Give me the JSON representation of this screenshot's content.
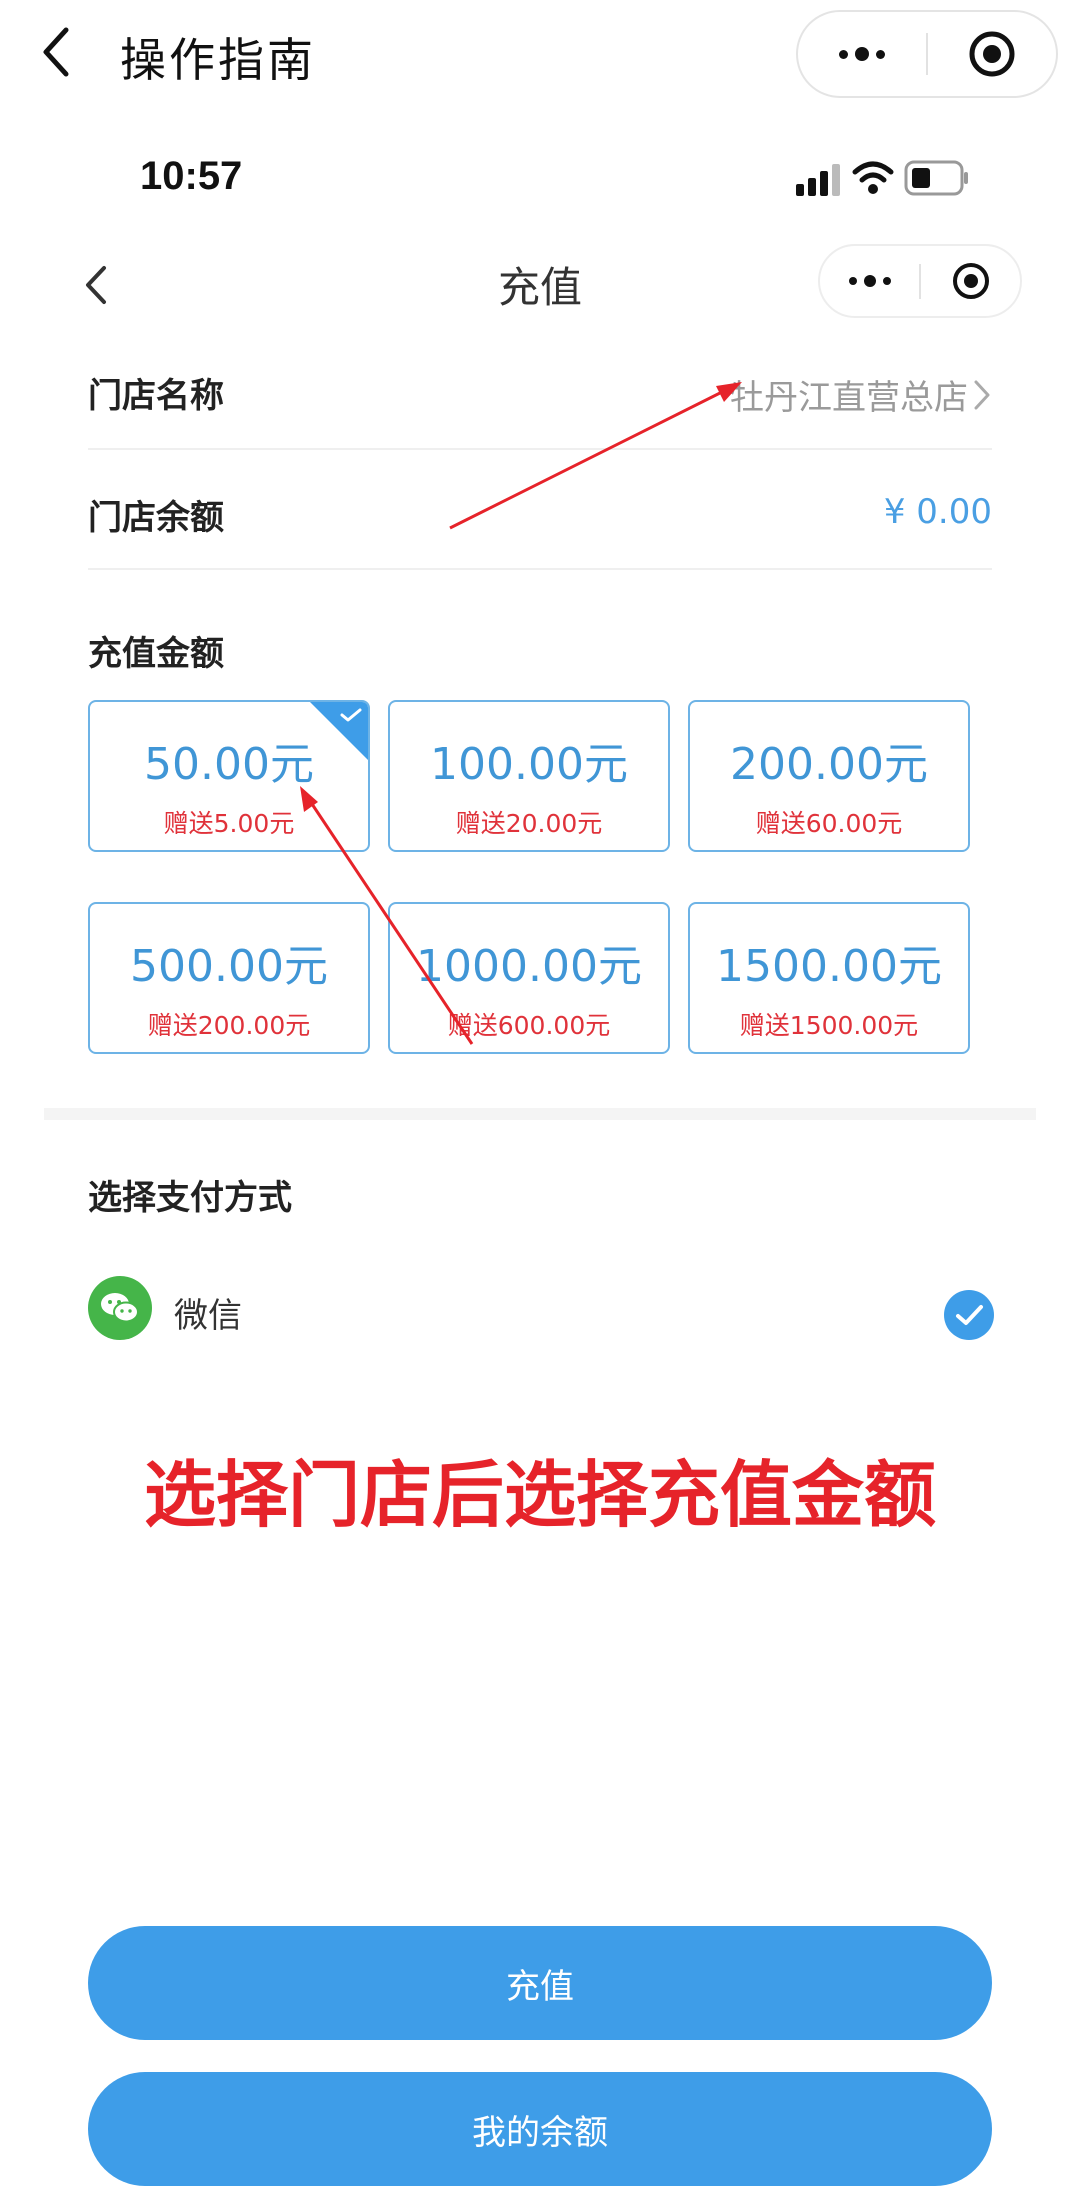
{
  "outer_nav": {
    "title": "操作指南"
  },
  "status_bar": {
    "time": "10:57"
  },
  "inner_nav": {
    "title": "充值"
  },
  "store": {
    "name_label": "门店名称",
    "name_value": "牡丹江直营总店",
    "balance_label": "门店余额",
    "balance_value": "¥ 0.00"
  },
  "recharge": {
    "section_label": "充值金额",
    "options": [
      {
        "amount": "50.00元",
        "bonus": "赠送5.00元",
        "selected": true
      },
      {
        "amount": "100.00元",
        "bonus": "赠送20.00元",
        "selected": false
      },
      {
        "amount": "200.00元",
        "bonus": "赠送60.00元",
        "selected": false
      },
      {
        "amount": "500.00元",
        "bonus": "赠送200.00元",
        "selected": false
      },
      {
        "amount": "1000.00元",
        "bonus": "赠送600.00元",
        "selected": false
      },
      {
        "amount": "1500.00元",
        "bonus": "赠送1500.00元",
        "selected": false
      }
    ]
  },
  "payment": {
    "section_label": "选择支付方式",
    "method_label": "微信",
    "method_icon": "wechat-icon",
    "selected": true
  },
  "annotation": "选择门店后选择充值金额",
  "buttons": {
    "recharge": "充值",
    "my_balance": "我的余额"
  },
  "colors": {
    "accent": "#3e9de8",
    "annotation_red": "#e6232a",
    "bonus_red": "#e0323a",
    "wechat_green": "#45b549"
  }
}
